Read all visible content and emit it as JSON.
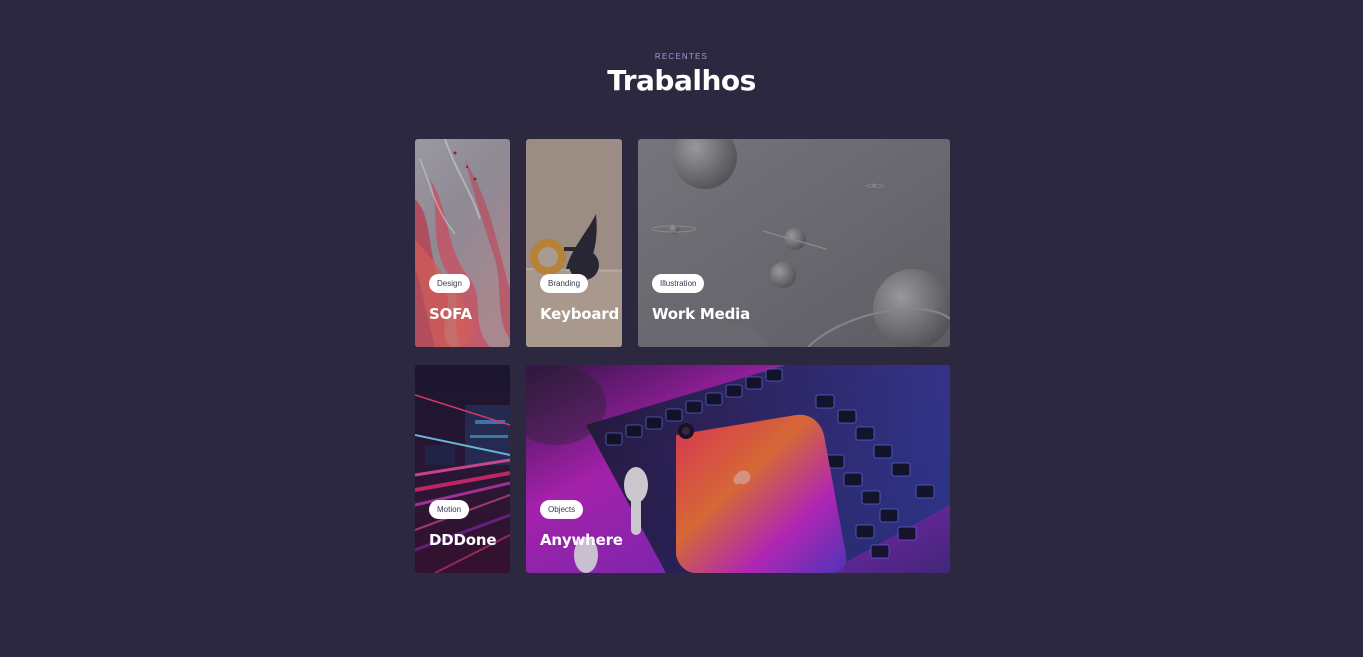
{
  "section": {
    "kicker": "RECENTES",
    "title": "Trabalhos"
  },
  "colors": {
    "background": "#2c283f",
    "kicker": "#a29bd4",
    "tag_bg": "#ffffff"
  },
  "projects": [
    {
      "tag": "Design",
      "title": "SOFA"
    },
    {
      "tag": "Branding",
      "title": "Keyboard"
    },
    {
      "tag": "Illustration",
      "title": "Work Media"
    },
    {
      "tag": "Motion",
      "title": "DDDone"
    },
    {
      "tag": "Objects",
      "title": "Anywhere"
    }
  ]
}
